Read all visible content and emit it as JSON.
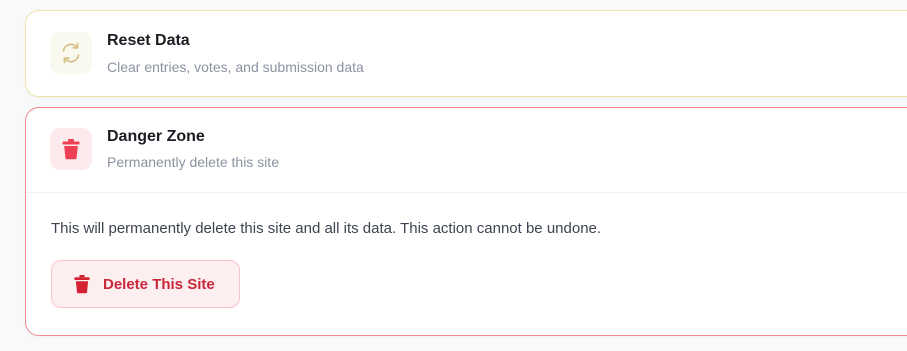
{
  "reset_card": {
    "icon": "refresh-icon",
    "title": "Reset Data",
    "subtitle": "Clear entries, votes, and submission data"
  },
  "danger_card": {
    "icon": "trash-icon",
    "title": "Danger Zone",
    "subtitle": "Permanently delete this site",
    "warning": "This will permanently delete this site and all its data. This action cannot be undone.",
    "button_label": "Delete This Site",
    "button_icon": "trash-icon"
  },
  "colors": {
    "reset_border": "#f1e3a8",
    "reset_icon": "#d8c08a",
    "danger_border": "#f08a8f",
    "danger_icon": "#ee3f55",
    "danger_button_text": "#c8283a",
    "danger_button_icon": "#d42233"
  }
}
